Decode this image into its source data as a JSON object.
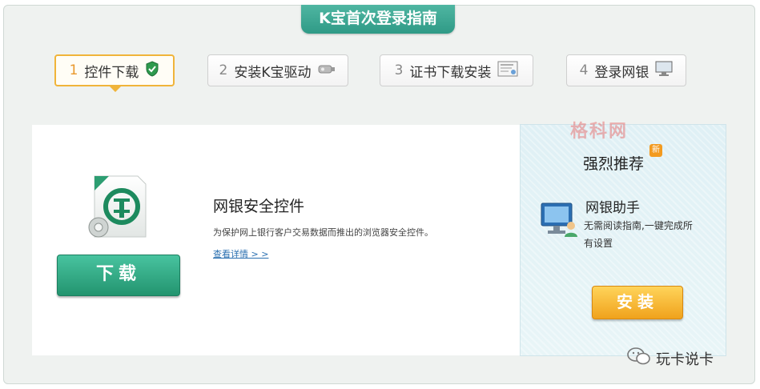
{
  "header": {
    "title": "K宝首次登录指南"
  },
  "steps": [
    {
      "number": "1",
      "label": "控件下载",
      "icon": "shield-icon",
      "active": true
    },
    {
      "number": "2",
      "label": "安装K宝驱动",
      "icon": "usb-key-icon",
      "active": false
    },
    {
      "number": "3",
      "label": "证书下载安装",
      "icon": "certificate-icon",
      "active": false
    },
    {
      "number": "4",
      "label": "登录网银",
      "icon": "monitor-icon",
      "active": false
    }
  ],
  "control": {
    "title": "网银安全控件",
    "description": "为保护网上银行客户交易数据而推出的浏览器安全控件。",
    "details_link": "查看详情 > >",
    "download_label": "下载",
    "icon": "abc-bank-security-icon"
  },
  "recommend": {
    "title": "强烈推荐",
    "badge": "新",
    "app_name": "网银助手",
    "app_desc": "无需阅读指南,一键完成所有设置",
    "install_label": "安装",
    "icon": "monitor-user-icon"
  },
  "watermark": "格科网",
  "brand": {
    "name": "玩卡说卡",
    "icon": "wechat-icon"
  },
  "colors": {
    "accent": "#2f9a86",
    "active_step": "#f0b43a",
    "download": "#23946f",
    "install": "#f0a21c"
  }
}
